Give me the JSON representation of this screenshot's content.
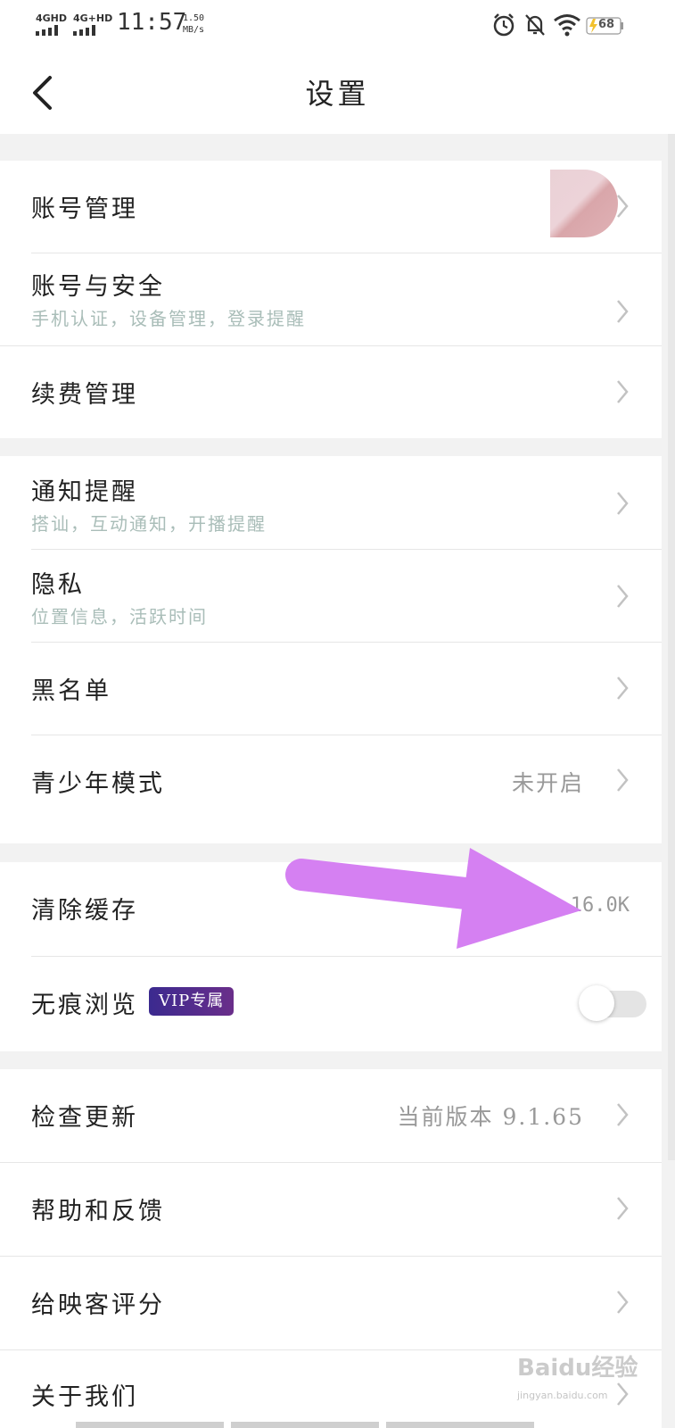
{
  "status_bar": {
    "network1": "4GHD",
    "network2": "4G+HD",
    "time": "11:57",
    "speed_value": "1.50",
    "speed_unit": "MB/s",
    "battery": "68",
    "icons": [
      "alarm-icon",
      "mute-icon",
      "wifi-icon",
      "battery-charging-icon"
    ]
  },
  "header": {
    "title": "设置",
    "back_icon": "chevron-left-icon"
  },
  "groups": [
    {
      "items": [
        {
          "label": "账号管理",
          "has_avatar": true
        },
        {
          "label": "账号与安全",
          "subtitle": "手机认证，设备管理，登录提醒"
        },
        {
          "label": "续费管理"
        }
      ]
    },
    {
      "items": [
        {
          "label": "通知提醒",
          "subtitle": "搭讪，互动通知，开播提醒"
        },
        {
          "label": "隐私",
          "subtitle": "位置信息，活跃时间"
        },
        {
          "label": "黑名单"
        },
        {
          "label": "青少年模式",
          "value": "未开启"
        }
      ]
    },
    {
      "items": [
        {
          "label": "清除缓存",
          "value": "16.0K"
        },
        {
          "label": "无痕浏览",
          "badge": "VIP专属",
          "toggle_on": false
        }
      ]
    },
    {
      "items": [
        {
          "label": "检查更新",
          "value": "当前版本 9.1.65"
        },
        {
          "label": "帮助和反馈"
        },
        {
          "label": "给映客评分"
        },
        {
          "label": "关于我们"
        }
      ]
    }
  ],
  "annotation": {
    "arrow_color": "#d580f2"
  },
  "watermark": {
    "logo": "Baidu经验",
    "url": "jingyan.baidu.com"
  },
  "colors": {
    "background": "#f2f2f2",
    "subtitle": "#a9bdb8",
    "value": "#999999",
    "vip_badge": "#4a2c8c"
  }
}
